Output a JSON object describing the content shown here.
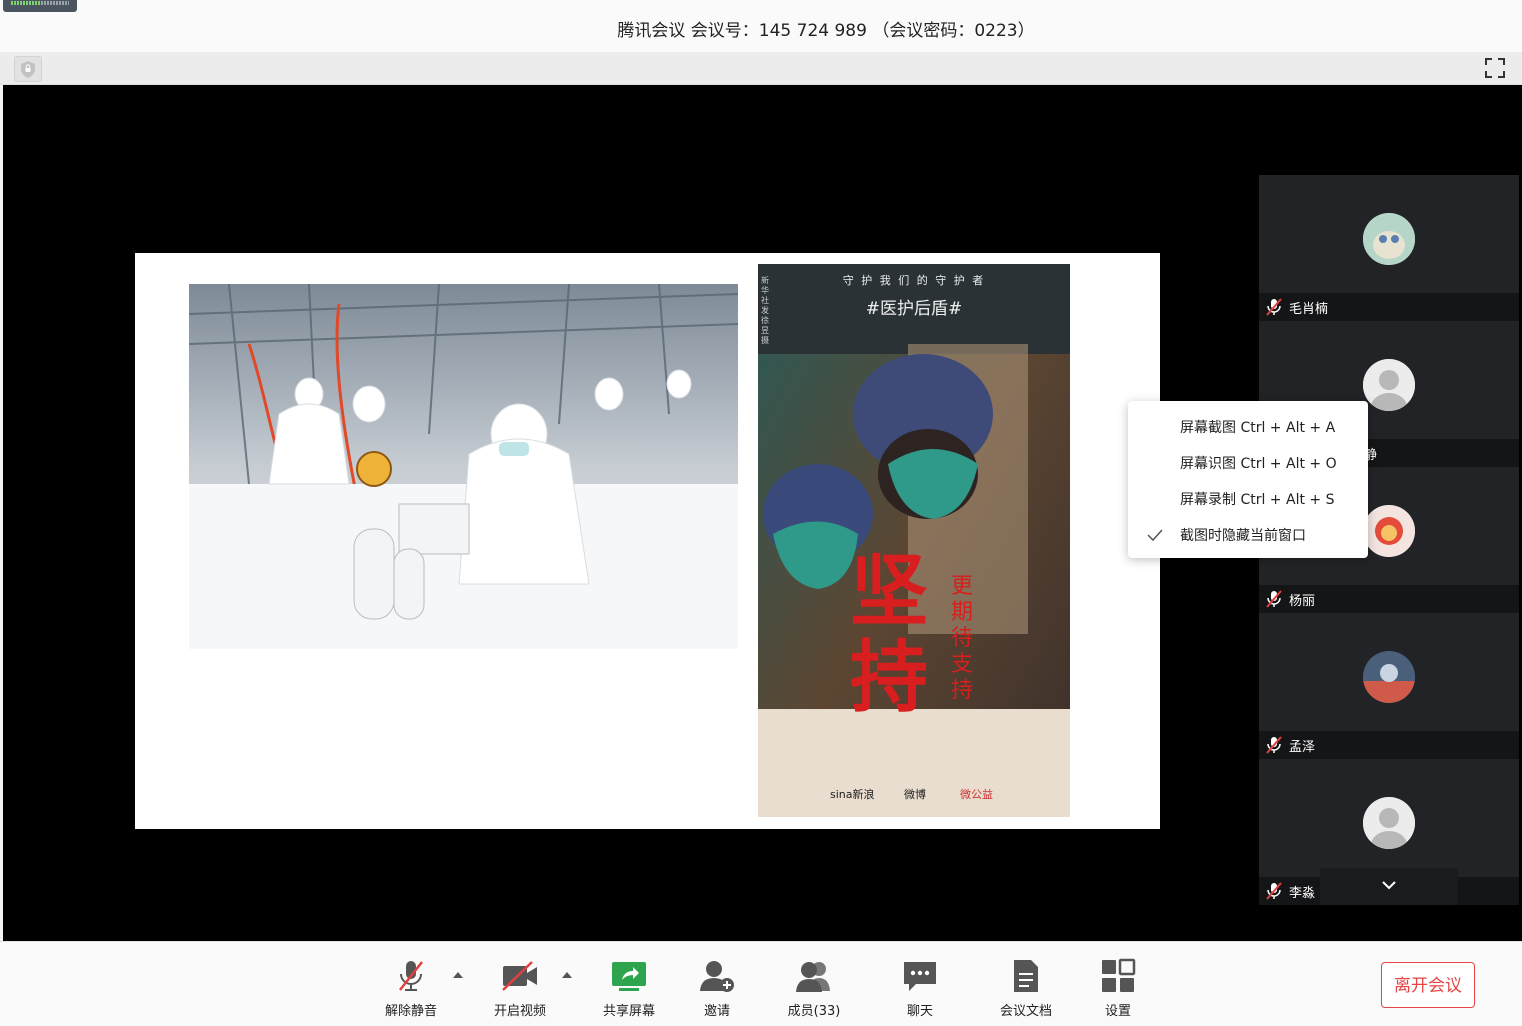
{
  "window": {
    "meeting_title": "腾讯会议 会议号：145 724 989 （会议密码：0223）"
  },
  "shared_content": {
    "poster": {
      "top_line": "守 护 我 们 的 守 护 者",
      "hashtag": "#医护后盾#",
      "headline": "坚持",
      "subline": "更期待支持",
      "side_text": "新华社发 徐昱 摄",
      "logos": [
        "sina新浪",
        "微博",
        "微公益"
      ]
    }
  },
  "participants": [
    {
      "name": "毛肖楠",
      "muted": true
    },
    {
      "name": "刘静",
      "muted": true
    },
    {
      "name": "杨丽",
      "muted": true
    },
    {
      "name": "孟泽",
      "muted": true
    },
    {
      "name": "李淼",
      "muted": true
    }
  ],
  "context_menu": {
    "items": [
      {
        "label": "屏幕截图 Ctrl + Alt + A",
        "checked": false
      },
      {
        "label": "屏幕识图 Ctrl + Alt + O",
        "checked": false
      },
      {
        "label": "屏幕录制 Ctrl + Alt + S",
        "checked": false
      },
      {
        "label": "截图时隐藏当前窗口",
        "checked": true
      }
    ]
  },
  "toolbar": {
    "unmute": "解除静音",
    "start_video": "开启视频",
    "share_screen": "共享屏幕",
    "invite": "邀请",
    "members": "成员(33)",
    "chat": "聊天",
    "docs": "会议文档",
    "settings": "设置",
    "leave": "离开会议"
  },
  "colors": {
    "accent_green": "#2ea44f",
    "leave_red": "#e54545",
    "mute_red": "#e04040"
  }
}
